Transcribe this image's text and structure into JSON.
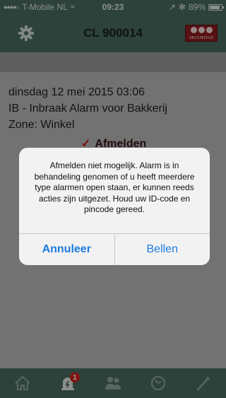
{
  "status_bar": {
    "signal": "●●●●○",
    "carrier": "T-Mobile NL",
    "wifi": "≈",
    "time": "09:23",
    "location_arrow": "↗",
    "bluetooth": "✻",
    "battery_percent": "89%",
    "battery_level": 0.89
  },
  "nav": {
    "title": "CL 900014",
    "logo_text": "SECURITAS",
    "settings_icon": "gear-icon"
  },
  "alarm": {
    "datetime": "dinsdag 12 mei 2015 03:06",
    "type": "IB - Inbraak Alarm voor Bakkerij",
    "zone": "Zone: Winkel",
    "partial_label": "Afmelden"
  },
  "dialog": {
    "message": "Afmelden niet mogelijk. Alarm is in behandeling genomen of u heeft meerdere type alarmen open staan, er kunnen reeds acties zijn uitgezet. Houd uw ID-code en pincode gereed.",
    "cancel_label": "Annuleer",
    "call_label": "Bellen"
  },
  "tabbar": {
    "tabs": [
      {
        "icon": "home-icon"
      },
      {
        "icon": "alarm-icon",
        "badge": "1"
      },
      {
        "icon": "contacts-icon"
      },
      {
        "icon": "history-icon"
      },
      {
        "icon": "wand-icon"
      }
    ]
  },
  "colors": {
    "bar": "#4a6b5e",
    "accent": "#1b7be0",
    "badge": "#d22020"
  }
}
